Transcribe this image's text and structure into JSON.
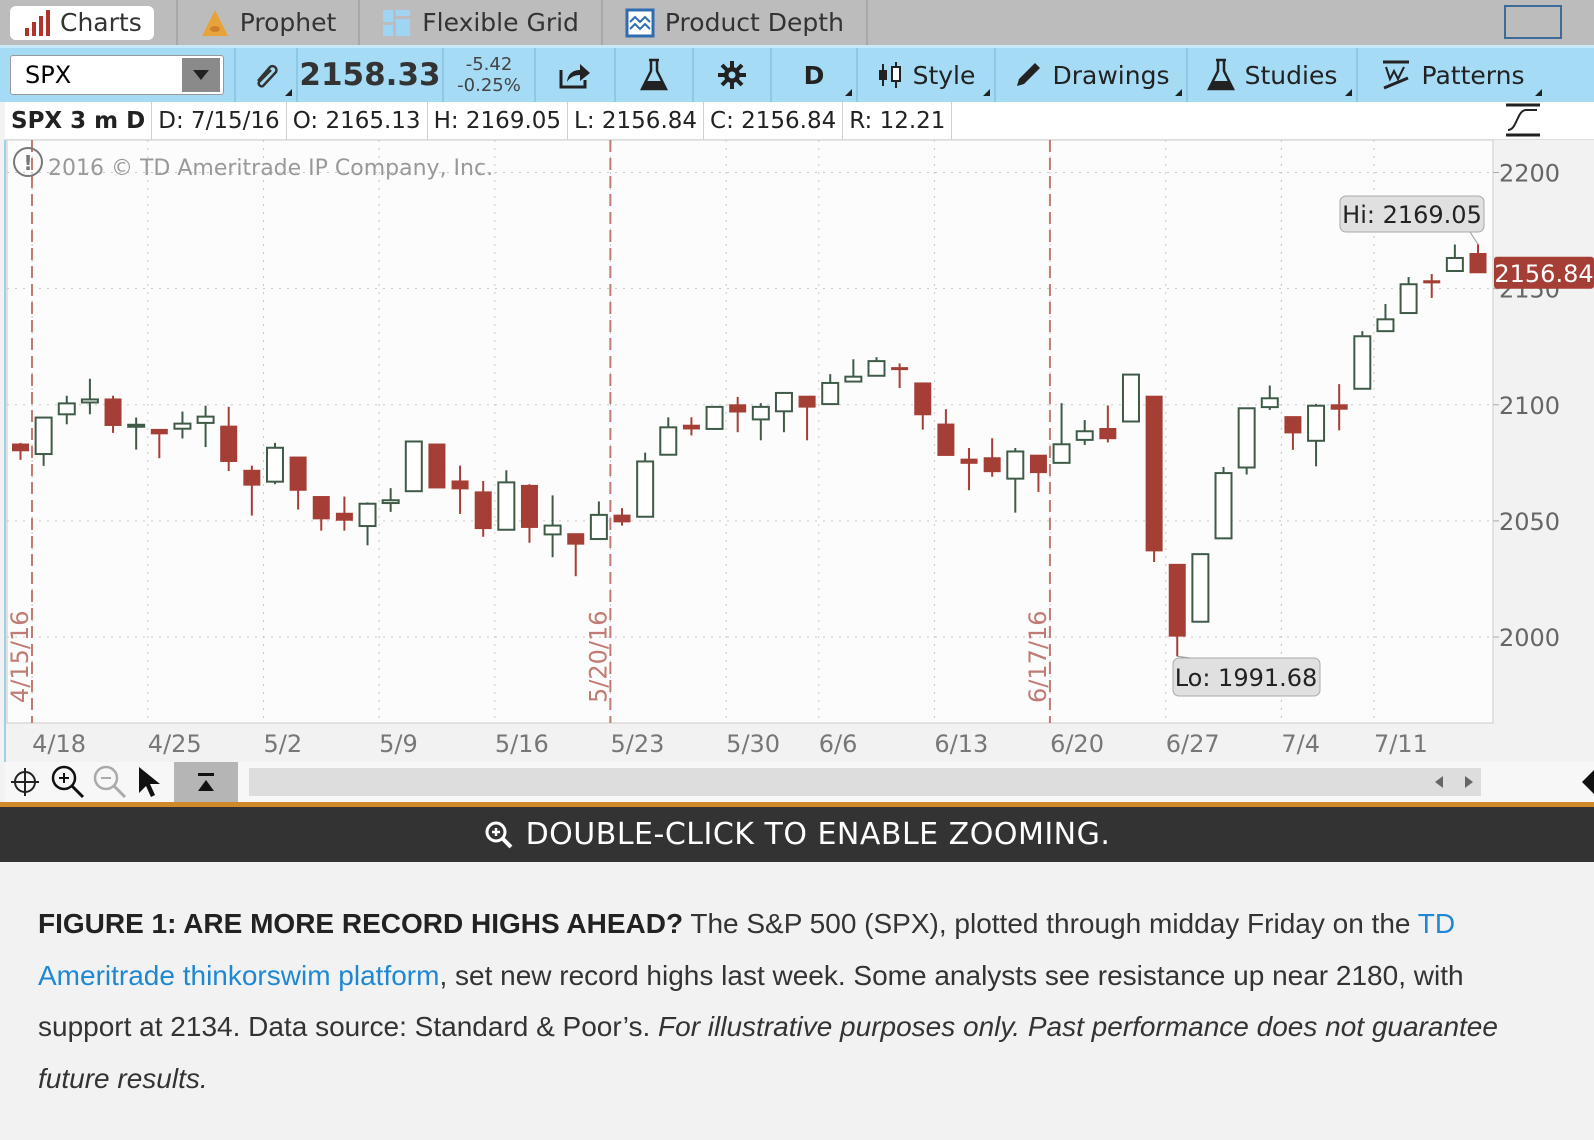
{
  "tabs": [
    {
      "label": "Charts",
      "active": true
    },
    {
      "label": "Prophet"
    },
    {
      "label": "Flexible Grid"
    },
    {
      "label": "Product Depth"
    }
  ],
  "toolbar": {
    "symbol": "SPX",
    "last": "2158.33",
    "change": "-5.42",
    "change_pct": "-0.25%",
    "aggregation": "D",
    "style": "Style",
    "drawings": "Drawings",
    "studies": "Studies",
    "patterns": "Patterns"
  },
  "info": {
    "title": "SPX 3 m D",
    "date": "D: 7/15/16",
    "open": "O: 2165.13",
    "high": "H: 2169.05",
    "low": "L: 2156.84",
    "close": "C: 2156.84",
    "range": "R: 12.21"
  },
  "copyright": "2016 © TD Ameritrade IP Company, Inc.",
  "banner": "DOUBLE-CLICK TO ENABLE ZOOMING.",
  "caption": {
    "heading": "FIGURE 1: ARE MORE RECORD HIGHS AHEAD?",
    "text1": " The S&P 500 (SPX), plotted through midday Friday on the ",
    "link": "TD Ameritrade thinkorswim platform",
    "text2": ", set new record highs last week. Some analysts see resistance up near 2180, with support at 2134. Data source: Standard & Poor’s. ",
    "italic": "For illustrative purposes only. Past performance does not guarantee future results."
  },
  "colors": {
    "up": "#3f5b47",
    "down": "#a53e35",
    "toolbar": "#a6dbf6",
    "marker": "#c27a74"
  },
  "chart_data": {
    "type": "candlestick",
    "ylim": [
      1963,
      2214
    ],
    "yticks": [
      2000,
      2050,
      2100,
      2150,
      2200
    ],
    "week_labels": [
      [
        "4/18",
        "4/18"
      ],
      [
        "4/25",
        "4/25"
      ],
      [
        "5/2",
        "5/2"
      ],
      [
        "5/9",
        "5/9"
      ],
      [
        "5/16",
        "5/16"
      ],
      [
        "5/23",
        "5/23"
      ],
      [
        "5/30",
        "5/31"
      ],
      [
        "6/6",
        "6/6"
      ],
      [
        "6/13",
        "6/13"
      ],
      [
        "6/20",
        "6/20"
      ],
      [
        "6/27",
        "6/27"
      ],
      [
        "7/4",
        "7/5"
      ],
      [
        "7/11",
        "7/11"
      ]
    ],
    "markers": [
      {
        "label": "4/15/16",
        "date": "4/15"
      },
      {
        "label": "5/20/16",
        "date": "5/20"
      },
      {
        "label": "6/17/16",
        "date": "6/17"
      }
    ],
    "hi_label": "Hi: 2169.05",
    "lo_label": "Lo: 1991.68",
    "last_label": "2156.84",
    "last_value": 2156.84,
    "candles_columns": [
      "date",
      "open",
      "high",
      "low",
      "close"
    ],
    "candles": [
      [
        "4/15",
        2083.1,
        2083.6,
        2076.3,
        2080.2
      ],
      [
        "4/18",
        2078.8,
        2094.8,
        2073.7,
        2094.5
      ],
      [
        "4/19",
        2095.9,
        2103.9,
        2091.6,
        2100.6
      ],
      [
        "4/20",
        2101.0,
        2111.2,
        2095.9,
        2102.3
      ],
      [
        "4/21",
        2102.5,
        2103.9,
        2087.9,
        2091.1
      ],
      [
        "4/22",
        2091.1,
        2094.5,
        2080.7,
        2091.4
      ],
      [
        "4/25",
        2089.4,
        2089.4,
        2077.0,
        2087.5
      ],
      [
        "4/26",
        2089.7,
        2097.1,
        2085.5,
        2091.9
      ],
      [
        "4/27",
        2092.2,
        2099.6,
        2081.8,
        2094.9
      ],
      [
        "4/28",
        2090.8,
        2099.1,
        2071.5,
        2075.6
      ],
      [
        "4/29",
        2071.8,
        2073.8,
        2052.3,
        2065.4
      ],
      [
        "5/2",
        2066.9,
        2083.6,
        2065.8,
        2081.5
      ],
      [
        "5/3",
        2077.5,
        2077.5,
        2054.9,
        2063.2
      ],
      [
        "5/4",
        2060.5,
        2060.5,
        2045.8,
        2050.9
      ],
      [
        "5/5",
        2053.3,
        2060.5,
        2045.8,
        2050.3
      ],
      [
        "5/6",
        2047.8,
        2058.0,
        2039.5,
        2057.4
      ],
      [
        "5/9",
        2057.7,
        2064.1,
        2053.9,
        2058.9
      ],
      [
        "5/10",
        2062.8,
        2084.6,
        2062.8,
        2084.2
      ],
      [
        "5/11",
        2083.1,
        2083.1,
        2064.2,
        2064.2
      ],
      [
        "5/12",
        2067.2,
        2073.8,
        2053.0,
        2063.8
      ],
      [
        "5/13",
        2062.5,
        2067.2,
        2043.2,
        2046.7
      ],
      [
        "5/16",
        2046.2,
        2071.8,
        2046.2,
        2066.6
      ],
      [
        "5/17",
        2065.3,
        2065.8,
        2040.6,
        2047.2
      ],
      [
        "5/18",
        2044.2,
        2061.0,
        2034.4,
        2048.0
      ],
      [
        "5/19",
        2044.5,
        2044.5,
        2026.2,
        2040.0
      ],
      [
        "5/20",
        2042.2,
        2058.4,
        2042.2,
        2052.6
      ],
      [
        "5/23",
        2052.5,
        2055.5,
        2048.0,
        2049.6
      ],
      [
        "5/24",
        2051.8,
        2079.4,
        2051.8,
        2075.6
      ],
      [
        "5/25",
        2078.5,
        2094.6,
        2078.5,
        2090.3
      ],
      [
        "5/26",
        2091.2,
        2094.6,
        2086.8,
        2089.6
      ],
      [
        "5/27",
        2089.6,
        2099.1,
        2089.6,
        2099.1
      ],
      [
        "5/31",
        2100.0,
        2103.4,
        2088.2,
        2096.9
      ],
      [
        "6/1",
        2093.7,
        2100.7,
        2084.7,
        2099.1
      ],
      [
        "6/2",
        2097.2,
        2105.1,
        2088.2,
        2105.1
      ],
      [
        "6/3",
        2103.7,
        2103.7,
        2084.7,
        2099.0
      ],
      [
        "6/6",
        2100.3,
        2113.2,
        2100.3,
        2109.4
      ],
      [
        "6/7",
        2110.0,
        2119.6,
        2110.0,
        2112.1
      ],
      [
        "6/8",
        2112.5,
        2120.5,
        2112.5,
        2118.8
      ],
      [
        "6/9",
        2116.0,
        2117.8,
        2107.2,
        2115.2
      ],
      [
        "6/10",
        2109.4,
        2109.4,
        2089.3,
        2095.7
      ],
      [
        "6/13",
        2091.7,
        2098.1,
        2078.2,
        2078.2
      ],
      [
        "6/14",
        2076.6,
        2081.4,
        2063.2,
        2074.8
      ],
      [
        "6/15",
        2077.2,
        2085.6,
        2069.0,
        2071.2
      ],
      [
        "6/16",
        2068.2,
        2081.4,
        2053.6,
        2079.9
      ],
      [
        "6/17",
        2078.3,
        2078.3,
        2062.5,
        2070.8
      ],
      [
        "6/20",
        2075.0,
        2100.7,
        2075.0,
        2083.0
      ],
      [
        "6/21",
        2084.9,
        2093.4,
        2082.7,
        2088.6
      ],
      [
        "6/22",
        2089.8,
        2099.7,
        2083.8,
        2085.4
      ],
      [
        "6/23",
        2092.8,
        2113.0,
        2092.8,
        2113.0
      ],
      [
        "6/24",
        2103.7,
        2103.7,
        2032.3,
        2037.1
      ],
      [
        "6/27",
        2031.3,
        2031.3,
        1991.68,
        2000.4
      ],
      [
        "6/28",
        2006.6,
        2035.7,
        2006.6,
        2035.7
      ],
      [
        "6/29",
        2042.5,
        2073.2,
        2042.5,
        2070.6
      ],
      [
        "6/30",
        2073.0,
        2098.5,
        2070.0,
        2098.5
      ],
      [
        "7/1",
        2099.0,
        2108.3,
        2097.8,
        2102.8
      ],
      [
        "7/5",
        2094.9,
        2094.9,
        2080.6,
        2087.9
      ],
      [
        "7/6",
        2084.5,
        2100.4,
        2073.5,
        2099.6
      ],
      [
        "7/7",
        2100.0,
        2108.9,
        2089.0,
        2098.1
      ],
      [
        "7/8",
        2106.9,
        2131.7,
        2106.9,
        2129.5
      ],
      [
        "7/11",
        2131.7,
        2143.4,
        2131.7,
        2136.8
      ],
      [
        "7/12",
        2139.5,
        2155.0,
        2139.5,
        2151.9
      ],
      [
        "7/13",
        2153.4,
        2156.3,
        2146.0,
        2152.5
      ],
      [
        "7/14",
        2157.6,
        2169.0,
        2157.6,
        2163.2
      ],
      [
        "7/15",
        2165.13,
        2169.05,
        2156.84,
        2156.84
      ]
    ]
  }
}
